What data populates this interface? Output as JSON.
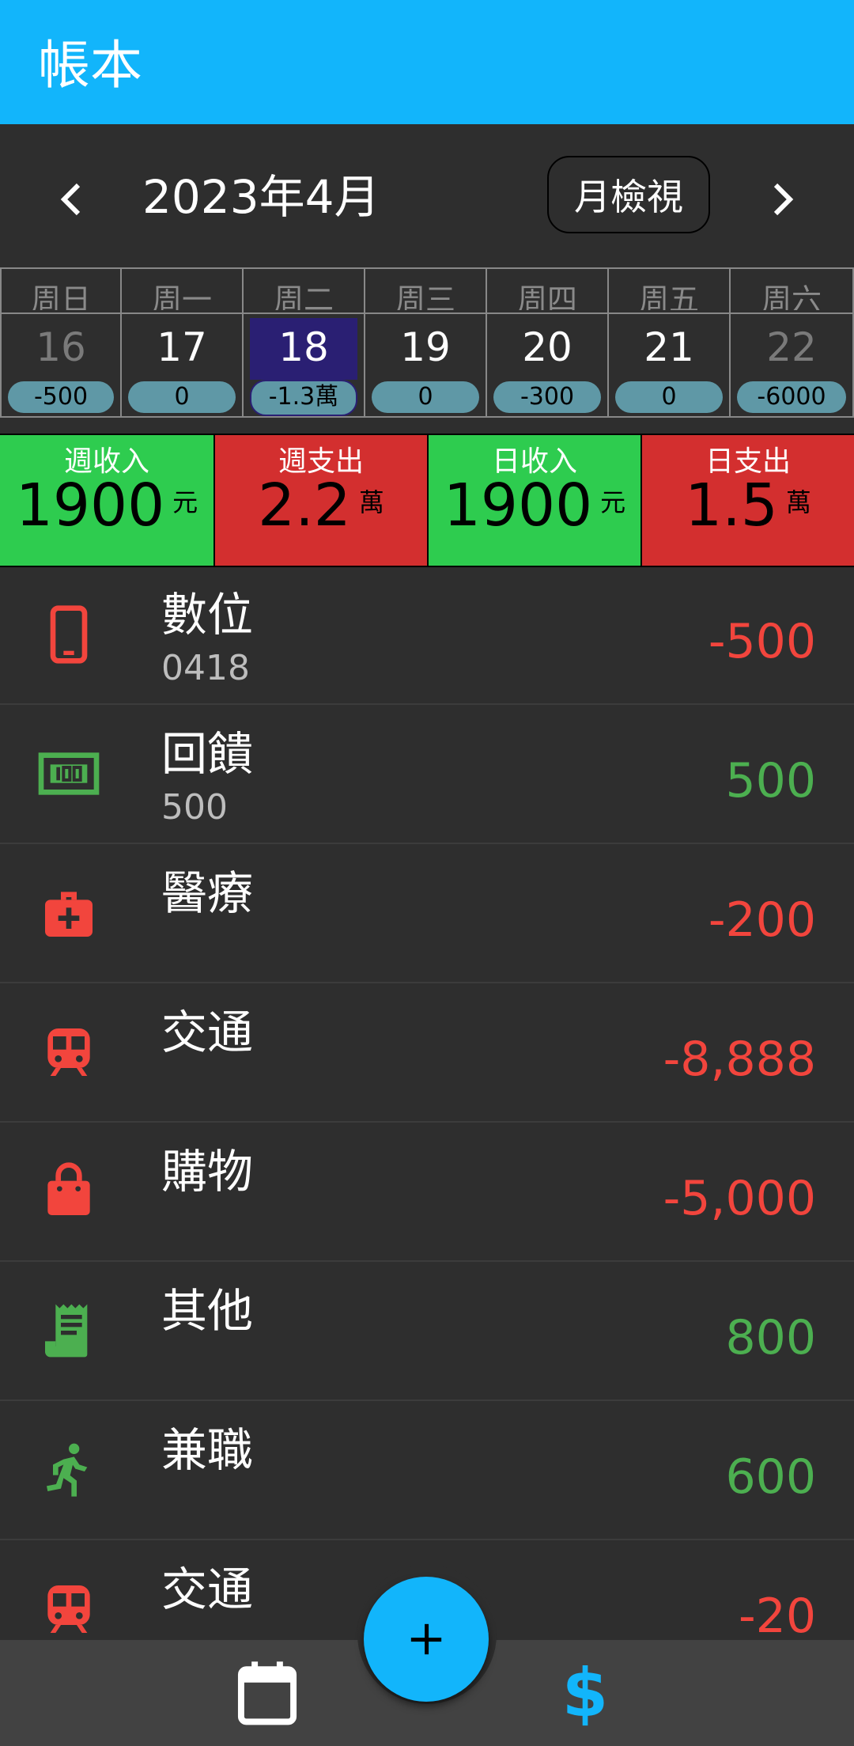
{
  "app": {
    "title": "帳本"
  },
  "month_nav": {
    "label": "2023年4月",
    "view_button": "月檢視",
    "prev_icon": "chevron-left-icon",
    "next_icon": "chevron-right-icon"
  },
  "week": {
    "days": [
      {
        "weekday": "周日",
        "date": "16",
        "amount": "-500",
        "dim": true
      },
      {
        "weekday": "周一",
        "date": "17",
        "amount": "0"
      },
      {
        "weekday": "周二",
        "date": "18",
        "amount": "-1.3萬",
        "selected": true
      },
      {
        "weekday": "周三",
        "date": "19",
        "amount": "0"
      },
      {
        "weekday": "周四",
        "date": "20",
        "amount": "-300"
      },
      {
        "weekday": "周五",
        "date": "21",
        "amount": "0"
      },
      {
        "weekday": "周六",
        "date": "22",
        "amount": "-6000",
        "dim": true
      }
    ]
  },
  "summary": [
    {
      "label": "週收入",
      "value": "1900",
      "unit": "元",
      "color": "#2ecc4f"
    },
    {
      "label": "週支出",
      "value": "2.2",
      "unit": "萬",
      "color": "#d32f2f"
    },
    {
      "label": "日收入",
      "value": "1900",
      "unit": "元",
      "color": "#2ecc4f"
    },
    {
      "label": "日支出",
      "value": "1.5",
      "unit": "萬",
      "color": "#d32f2f"
    }
  ],
  "transactions": [
    {
      "category": "數位",
      "note": "0418",
      "amount": "-500",
      "icon": "smartphone-icon",
      "type": "expense"
    },
    {
      "category": "回饋",
      "note": "500",
      "amount": "500",
      "icon": "cash-100-icon",
      "type": "income"
    },
    {
      "category": "醫療",
      "note": "",
      "amount": "-200",
      "icon": "medical-bag-icon",
      "type": "expense"
    },
    {
      "category": "交通",
      "note": "",
      "amount": "-8,888",
      "icon": "train-icon",
      "type": "expense"
    },
    {
      "category": "購物",
      "note": "",
      "amount": "-5,000",
      "icon": "shopping-bag-icon",
      "type": "expense"
    },
    {
      "category": "其他",
      "note": "",
      "amount": "800",
      "icon": "receipt-icon",
      "type": "income"
    },
    {
      "category": "兼職",
      "note": "",
      "amount": "600",
      "icon": "running-icon",
      "type": "income"
    },
    {
      "category": "交通",
      "note": "",
      "amount": "-20",
      "icon": "train-icon",
      "type": "expense"
    }
  ],
  "colors": {
    "appbar": "#12b5fb",
    "income": "#4caf50",
    "expense": "#f2453d",
    "selected_day": "#2a1f73",
    "day_chip": "#5f98a6"
  },
  "bottom_nav": {
    "add_icon": "plus-icon",
    "calendar_icon": "calendar-icon",
    "money_symbol": "$"
  }
}
